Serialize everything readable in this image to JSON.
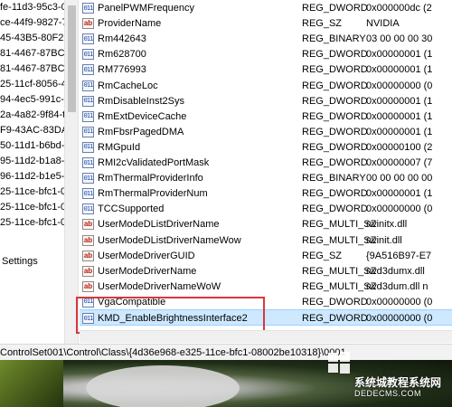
{
  "tree": {
    "items": [
      "fe-11d3-95c3-0",
      "ce-44f9-9827-7",
      "45-43B5-80F2-",
      "81-4467-87BC-",
      "81-4467-87BC-",
      "25-11cf-8056-4",
      "94-4ec5-991c-d",
      "2a-4a82-9f84-t",
      "F9-43AC-83DA-",
      "50-11d1-b6bd-",
      "95-11d2-b1a8-",
      "96-11d2-b1e5-0",
      "25-11ce-bfc1-0",
      "25-11ce-bfc1-0",
      "25-11ce-bfc1-0"
    ],
    "settings_label": "Settings"
  },
  "values": [
    {
      "name": "PanelPWMFrequency",
      "type": "REG_DWORD",
      "data": "0x000000dc (2",
      "icon": "binary-value-icon"
    },
    {
      "name": "ProviderName",
      "type": "REG_SZ",
      "data": "NVIDIA",
      "icon": "string-value-icon"
    },
    {
      "name": "Rm442643",
      "type": "REG_BINARY",
      "data": "03 00 00 00 30",
      "icon": "binary-value-icon"
    },
    {
      "name": "Rm628700",
      "type": "REG_DWORD",
      "data": "0x00000001 (1",
      "icon": "binary-value-icon"
    },
    {
      "name": "RM776993",
      "type": "REG_DWORD",
      "data": "0x00000001 (1",
      "icon": "binary-value-icon"
    },
    {
      "name": "RmCacheLoc",
      "type": "REG_DWORD",
      "data": "0x00000000 (0",
      "icon": "binary-value-icon"
    },
    {
      "name": "RmDisableInst2Sys",
      "type": "REG_DWORD",
      "data": "0x00000001 (1",
      "icon": "binary-value-icon"
    },
    {
      "name": "RmExtDeviceCache",
      "type": "REG_DWORD",
      "data": "0x00000001 (1",
      "icon": "binary-value-icon"
    },
    {
      "name": "RmFbsrPagedDMA",
      "type": "REG_DWORD",
      "data": "0x00000001 (1",
      "icon": "binary-value-icon"
    },
    {
      "name": "RMGpuId",
      "type": "REG_DWORD",
      "data": "0x00000100 (2",
      "icon": "binary-value-icon"
    },
    {
      "name": "RMI2cValidatedPortMask",
      "type": "REG_DWORD",
      "data": "0x00000007 (7",
      "icon": "binary-value-icon"
    },
    {
      "name": "RmThermalProviderInfo",
      "type": "REG_BINARY",
      "data": "00 00 00 00 00",
      "icon": "binary-value-icon"
    },
    {
      "name": "RmThermalProviderNum",
      "type": "REG_DWORD",
      "data": "0x00000001 (1",
      "icon": "binary-value-icon"
    },
    {
      "name": "TCCSupported",
      "type": "REG_DWORD",
      "data": "0x00000000 (0",
      "icon": "binary-value-icon"
    },
    {
      "name": "UserModeDListDriverName",
      "type": "REG_MULTI_SZ",
      "data": "nvinitx.dll",
      "icon": "string-value-icon"
    },
    {
      "name": "UserModeDListDriverNameWow",
      "type": "REG_MULTI_SZ",
      "data": "nvinit.dll",
      "icon": "string-value-icon"
    },
    {
      "name": "UserModeDriverGUID",
      "type": "REG_SZ",
      "data": "{9A516B97-E7",
      "icon": "string-value-icon"
    },
    {
      "name": "UserModeDriverName",
      "type": "REG_MULTI_SZ",
      "data": "nvd3dumx.dll",
      "icon": "string-value-icon"
    },
    {
      "name": "UserModeDriverNameWoW",
      "type": "REG_MULTI_SZ",
      "data": "nvd3dum.dll n",
      "icon": "string-value-icon"
    },
    {
      "name": "VgaCompatible",
      "type": "REG_DWORD",
      "data": "0x00000000 (0",
      "icon": "binary-value-icon"
    },
    {
      "name": "KMD_EnableBrightnessInterface2",
      "type": "REG_DWORD",
      "data": "0x00000000 (0",
      "icon": "binary-value-icon",
      "selected": true
    }
  ],
  "status_bar": {
    "path": "ControlSet001\\Control\\Class\\{4d36e968-e325-11ce-bfc1-08002be10318}\\0001"
  },
  "colors": {
    "highlight_box": "#d9363e",
    "selected_row": "#cde8ff"
  },
  "watermark": {
    "text": "系统城教程系统网",
    "url": "DEDECMS.COM"
  }
}
